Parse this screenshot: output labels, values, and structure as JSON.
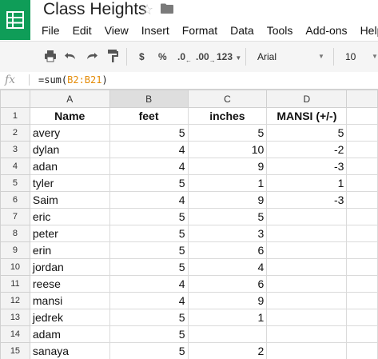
{
  "app": {
    "title": "Class Heights",
    "menu": [
      "File",
      "Edit",
      "View",
      "Insert",
      "Format",
      "Data",
      "Tools",
      "Add-ons",
      "Help"
    ]
  },
  "toolbar": {
    "currency": "$",
    "percent": "%",
    "decrease_decimals": ".0",
    "increase_decimals": ".00",
    "more_formats": "123",
    "font": "Arial",
    "font_size": "10"
  },
  "formula_bar": {
    "fx": "fx",
    "formula_prefix": "=sum(",
    "formula_ref": "B2:B21",
    "formula_suffix": ")"
  },
  "sheet": {
    "columns": [
      "A",
      "B",
      "C",
      "D"
    ],
    "rows": [
      {
        "n": "1",
        "a": "Name",
        "b": "feet",
        "c": "inches",
        "d": "MANSI (+/-)"
      },
      {
        "n": "2",
        "a": "avery",
        "b": "5",
        "c": "5",
        "d": "5"
      },
      {
        "n": "3",
        "a": "dylan",
        "b": "4",
        "c": "10",
        "d": "-2"
      },
      {
        "n": "4",
        "a": "adan",
        "b": "4",
        "c": "9",
        "d": "-3"
      },
      {
        "n": "5",
        "a": "tyler",
        "b": "5",
        "c": "1",
        "d": "1"
      },
      {
        "n": "6",
        "a": "Saim",
        "b": "4",
        "c": "9",
        "d": "-3"
      },
      {
        "n": "7",
        "a": "eric",
        "b": "5",
        "c": "5",
        "d": ""
      },
      {
        "n": "8",
        "a": "peter",
        "b": "5",
        "c": "3",
        "d": ""
      },
      {
        "n": "9",
        "a": "erin",
        "b": "5",
        "c": "6",
        "d": ""
      },
      {
        "n": "10",
        "a": "jordan",
        "b": "5",
        "c": "4",
        "d": ""
      },
      {
        "n": "11",
        "a": "reese",
        "b": "4",
        "c": "6",
        "d": ""
      },
      {
        "n": "12",
        "a": "mansi",
        "b": "4",
        "c": "9",
        "d": ""
      },
      {
        "n": "13",
        "a": "jedrek",
        "b": "5",
        "c": "1",
        "d": ""
      },
      {
        "n": "14",
        "a": "adam",
        "b": "5",
        "c": "",
        "d": ""
      },
      {
        "n": "15",
        "a": "sanaya",
        "b": "5",
        "c": "2",
        "d": ""
      }
    ]
  }
}
